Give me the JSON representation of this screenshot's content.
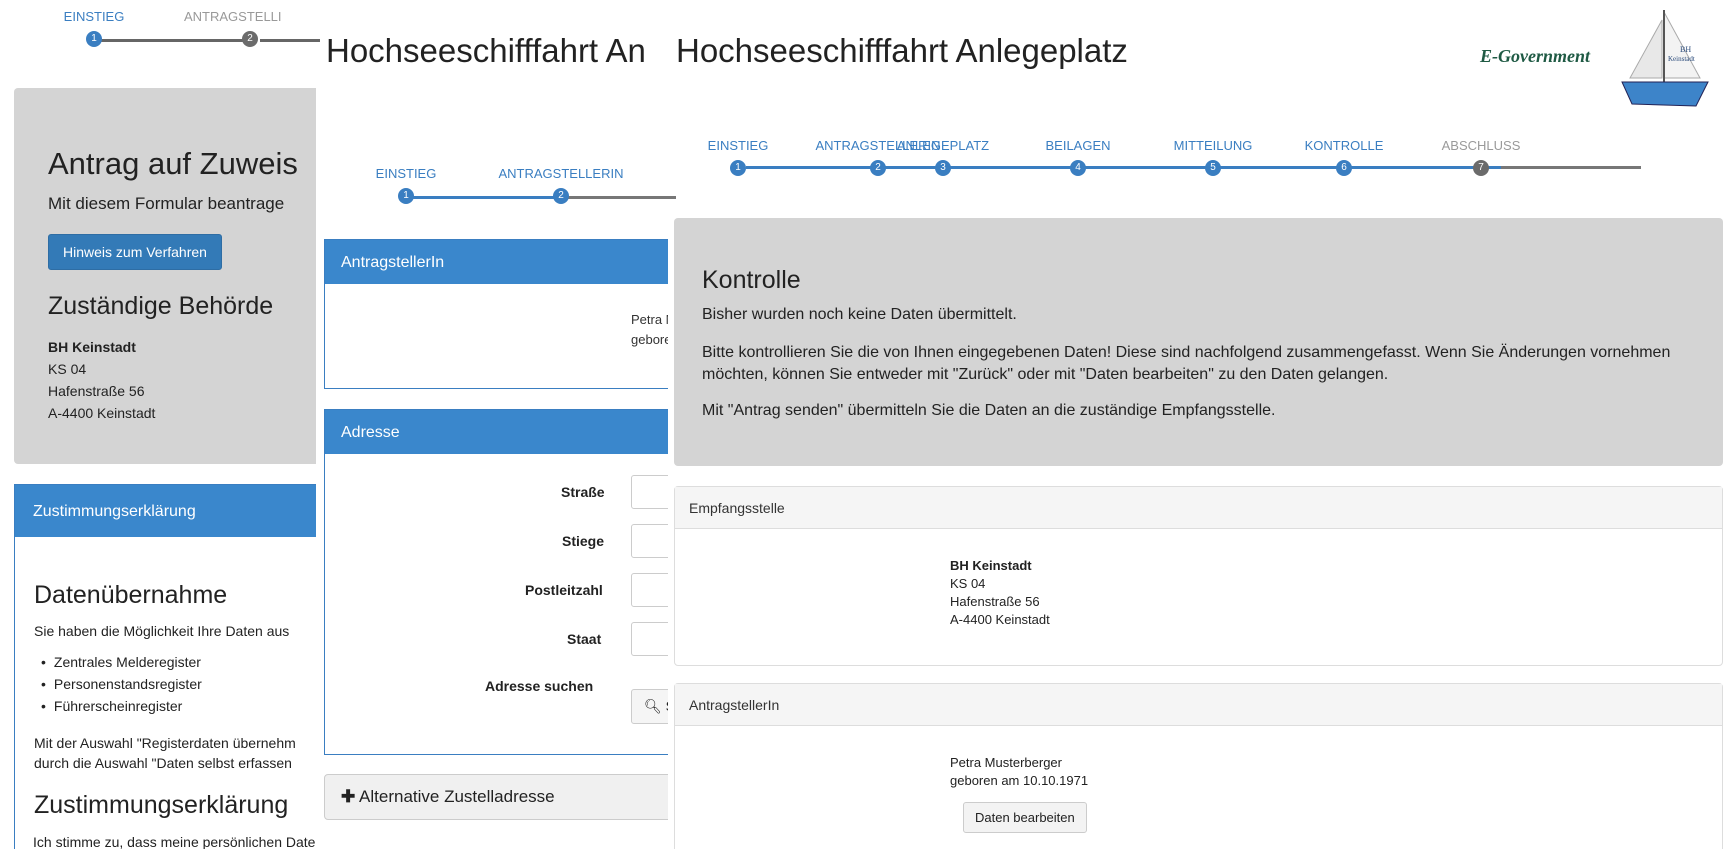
{
  "layer1": {
    "stepper": [
      "EINSTIEG",
      "ANTRAGSTELLI"
    ],
    "step_numbers": [
      "1",
      "2"
    ],
    "heading": "Antrag auf Zuweis",
    "lead": "Mit diesem Formular beantrage",
    "info_button": "Hinweis zum Verfahren",
    "authority_heading": "Zuständige Behörde",
    "authority": {
      "name": "BH Keinstadt",
      "line1": "KS 04",
      "line2": "Hafenstraße 56",
      "line3": "A-4400 Keinstadt"
    },
    "consent_panel_title": "Zustimmungserklärung",
    "data_heading": "Datenübernahme",
    "data_text": "Sie haben die Möglichkeit Ihre Daten aus",
    "registers": [
      "Zentrales Melderegister",
      "Personenstandsregister",
      "Führerscheinregister"
    ],
    "data_text2_line1": "Mit der Auswahl \"Registerdaten übernehm",
    "data_text2_line2": "durch die Auswahl \"Daten selbst erfassen",
    "consent_heading": "Zustimmungserklärung",
    "consent_text": "Ich stimme zu, dass meine persönlichen Daten aus den oben genannten Registern für die Vo"
  },
  "layer2": {
    "title": "Hochseeschifffahrt An",
    "stepper": [
      "EINSTIEG",
      "ANTRAGSTELLERIN"
    ],
    "step_numbers": [
      "1",
      "2"
    ],
    "applicant_panel_title": "AntragstellerIn",
    "applicant_name_partial": "Petra M",
    "applicant_birth_partial": "gebore",
    "address_panel_title": "Adresse",
    "fields": [
      "Straße",
      "Stiege",
      "Postleitzahl",
      "Staat"
    ],
    "address_search_label": "Adresse suchen",
    "search_button": "Su",
    "alt_address_button": "Alternative Zustelladresse"
  },
  "layer3": {
    "title": "Hochseeschifffahrt Anlegeplatz",
    "logo_text": "E-Government",
    "boat_label_1": "BH",
    "boat_label_2": "Keinstadt",
    "stepper": [
      "EINSTIEG",
      "ANTRAGSTELLERIN",
      "ANLEGEPLATZ",
      "BEILAGEN",
      "MITTEILUNG",
      "KONTROLLE",
      "ABSCHLUSS"
    ],
    "step_numbers": [
      "1",
      "2",
      "3",
      "4",
      "5",
      "6",
      "7"
    ],
    "control_heading": "Kontrolle",
    "control_p1": "Bisher wurden noch keine Daten übermittelt.",
    "control_p2": "Bitte kontrollieren Sie die von Ihnen eingegebenen Daten! Diese sind nachfolgend zusammengefasst. Wenn Sie Änderungen vornehmen möchten, können Sie entweder mit \"Zurück\" oder mit \"Daten bearbeiten\" zu den Daten gelangen.",
    "control_p3": "Mit \"Antrag senden\" übermitteln Sie die Daten an die zuständige Empfangsstelle.",
    "recipient_panel_title": "Empfangsstelle",
    "recipient": {
      "name": "BH Keinstadt",
      "line1": "KS 04",
      "line2": "Hafenstraße 56",
      "line3": "A-4400 Keinstadt"
    },
    "applicant_panel_title": "AntragstellerIn",
    "applicant_name": "Petra Musterberger",
    "applicant_birth": "geboren am 10.10.1971",
    "edit_button": "Daten bearbeiten"
  },
  "colors": {
    "primary": "#3a7ec1",
    "panel_head": "#3a87cc",
    "jumbotron": "#d4d4d4",
    "muted_step": "#9a9a9a"
  }
}
